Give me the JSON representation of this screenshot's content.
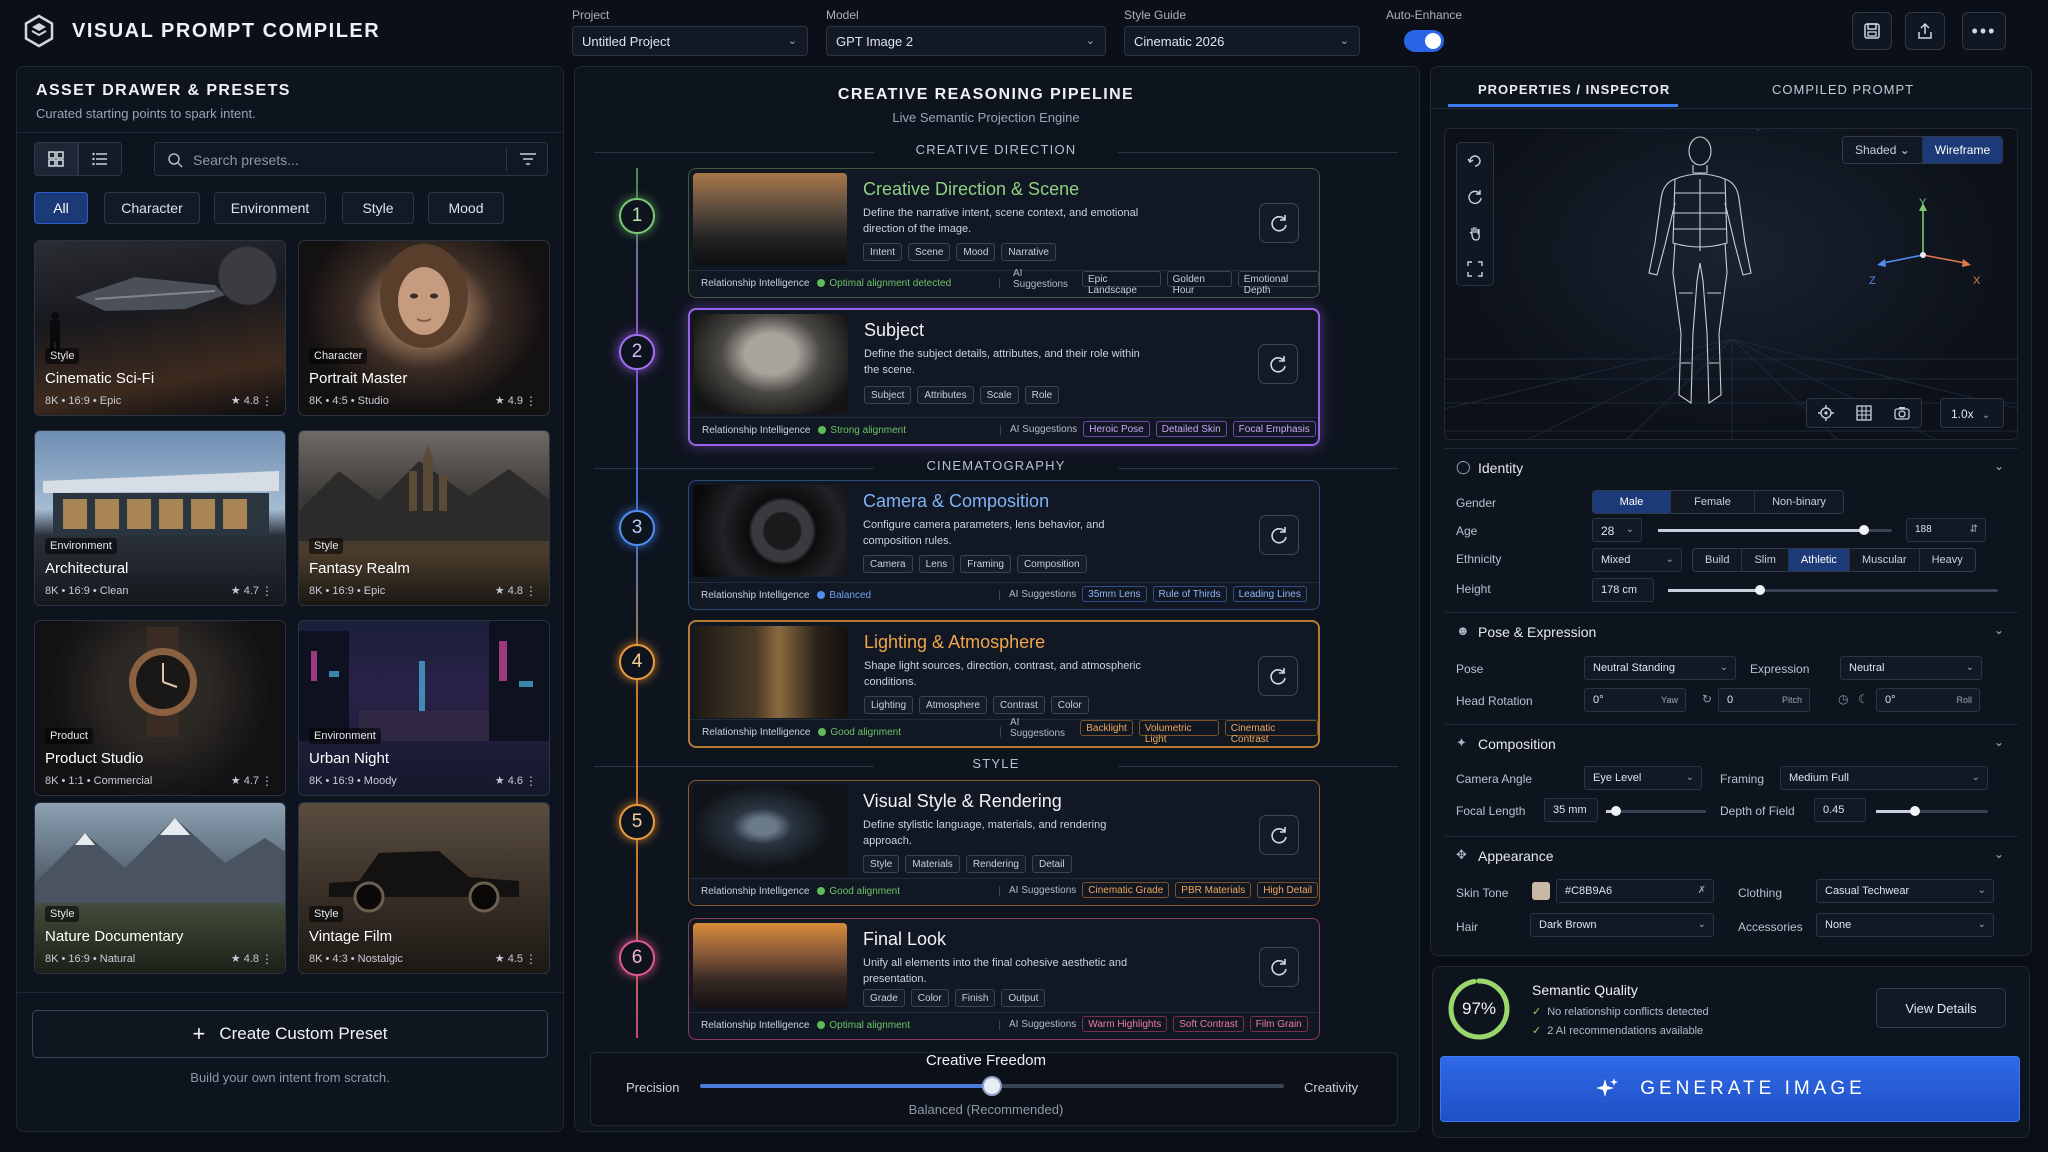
{
  "app": {
    "title": "VISUAL PROMPT COMPILER"
  },
  "topbar": {
    "project_label": "Project",
    "project_value": "Untitled Project",
    "model_label": "Model",
    "model_value": "GPT Image 2",
    "style_label": "Style Guide",
    "style_value": "Cinematic 2026",
    "auto_label": "Auto-Enhance",
    "auto_on": true,
    "icons": [
      "save-icon",
      "share-icon",
      "more-icon"
    ]
  },
  "assets": {
    "title": "ASSET DRAWER & PRESETS",
    "subtitle": "Curated starting points to spark intent.",
    "search_placeholder": "Search presets...",
    "filters": [
      "All",
      "Character",
      "Environment",
      "Style",
      "Mood"
    ],
    "active_filter": "All",
    "presets": [
      {
        "category": "Style",
        "name": "Cinematic Sci-Fi",
        "meta": "8K • 16:9 • Epic",
        "rating": "★ 4.8"
      },
      {
        "category": "Character",
        "name": "Portrait Master",
        "meta": "8K • 4:5 • Studio",
        "rating": "★ 4.9"
      },
      {
        "category": "Environment",
        "name": "Architectural",
        "meta": "8K • 16:9 • Clean",
        "rating": "★ 4.7"
      },
      {
        "category": "Style",
        "name": "Fantasy Realm",
        "meta": "8K • 16:9 • Epic",
        "rating": "★ 4.8"
      },
      {
        "category": "Product",
        "name": "Product Studio",
        "meta": "8K • 1:1 • Commercial",
        "rating": "★ 4.7"
      },
      {
        "category": "Environment",
        "name": "Urban Night",
        "meta": "8K • 16:9 • Moody",
        "rating": "★ 4.6"
      },
      {
        "category": "Style",
        "name": "Nature Documentary",
        "meta": "8K • 16:9 • Natural",
        "rating": "★ 4.8"
      },
      {
        "category": "Style",
        "name": "Vintage Film",
        "meta": "8K • 4:3 • Nostalgic",
        "rating": "★ 4.5"
      }
    ],
    "create_label": "Create Custom Preset",
    "create_hint": "Build your own intent from scratch."
  },
  "pipeline": {
    "title": "CREATIVE REASONING PIPELINE",
    "subtitle": "Live Semantic Projection Engine",
    "sections": [
      "CREATIVE DIRECTION",
      "CINEMATOGRAPHY",
      "STYLE"
    ],
    "ri_label": "Relationship Intelligence",
    "ai_label": "AI Suggestions",
    "steps": [
      {
        "n": "1",
        "title": "Creative Direction & Scene",
        "desc": "Define the narrative intent, scene context, and emotional direction of the image.",
        "tags": [
          "Intent",
          "Scene",
          "Mood",
          "Narrative"
        ],
        "status": "Optimal alignment detected",
        "suggestions": [
          "Epic Landscape",
          "Golden Hour",
          "Emotional Depth"
        ],
        "color": "#7cc873"
      },
      {
        "n": "2",
        "title": "Subject",
        "desc": "Define the subject details, attributes, and their role within the scene.",
        "tags": [
          "Subject",
          "Attributes",
          "Scale",
          "Role"
        ],
        "status": "Strong alignment",
        "suggestions": [
          "Heroic Pose",
          "Detailed Skin",
          "Focal Emphasis"
        ],
        "color": "#a46ef0"
      },
      {
        "n": "3",
        "title": "Camera & Composition",
        "desc": "Configure camera parameters, lens behavior, and composition rules.",
        "tags": [
          "Camera",
          "Lens",
          "Framing",
          "Composition"
        ],
        "status": "Balanced",
        "suggestions": [
          "35mm Lens",
          "Rule of Thirds",
          "Leading Lines"
        ],
        "color": "#4f8df0"
      },
      {
        "n": "4",
        "title": "Lighting & Atmosphere",
        "desc": "Shape light sources, direction, contrast, and atmospheric conditions.",
        "tags": [
          "Lighting",
          "Atmosphere",
          "Contrast",
          "Color"
        ],
        "status": "Good alignment",
        "suggestions": [
          "Backlight",
          "Volumetric Light",
          "Cinematic Contrast"
        ],
        "color": "#e89a3c"
      },
      {
        "n": "5",
        "title": "Visual Style & Rendering",
        "desc": "Define stylistic language, materials, and rendering approach.",
        "tags": [
          "Style",
          "Materials",
          "Rendering",
          "Detail"
        ],
        "status": "Good alignment",
        "suggestions": [
          "Cinematic Grade",
          "PBR Materials",
          "High Detail"
        ],
        "color": "#e89a3c"
      },
      {
        "n": "6",
        "title": "Final Look",
        "desc": "Unify all elements into the final cohesive aesthetic and presentation.",
        "tags": [
          "Grade",
          "Color",
          "Finish",
          "Output"
        ],
        "status": "Optimal alignment",
        "suggestions": [
          "Warm Highlights",
          "Soft Contrast",
          "Film Grain"
        ],
        "color": "#e0568e"
      }
    ],
    "freedom": {
      "title": "Creative Freedom",
      "left": "Precision",
      "right": "Creativity",
      "value_label": "Balanced (Recommended)",
      "value": 0.5
    }
  },
  "inspector": {
    "tabs": [
      "PROPERTIES / INSPECTOR",
      "COMPILED PROMPT"
    ],
    "active_tab": 0,
    "viewport": {
      "modes": [
        "Shaded",
        "Wireframe"
      ],
      "active_mode": "Wireframe",
      "zoom": "1.0x",
      "axes": [
        "Y",
        "Z",
        "X"
      ]
    },
    "identity": {
      "title": "Identity",
      "gender_label": "Gender",
      "gender_options": [
        "Male",
        "Female",
        "Non-binary"
      ],
      "gender_selected": "Male",
      "age_label": "Age",
      "age_value": "28",
      "age_max": "188",
      "age_fraction": 0.88,
      "ethnicity_label": "Ethnicity",
      "ethnicity_value": "Mixed",
      "build_options": [
        "Build",
        "Slim",
        "Athletic",
        "Muscular",
        "Heavy"
      ],
      "build_selected": "Athletic",
      "height_label": "Height",
      "height_value": "178 cm",
      "height_fraction": 0.28
    },
    "pose": {
      "title": "Pose & Expression",
      "pose_label": "Pose",
      "pose_value": "Neutral Standing",
      "expression_label": "Expression",
      "expression_value": "Neutral",
      "head_label": "Head Rotation",
      "yaw": "0°",
      "yaw_label": "Yaw",
      "pitch": "0",
      "pitch_label": "Pitch",
      "roll": "0°",
      "roll_label": "Roll"
    },
    "composition": {
      "title": "Composition",
      "angle_label": "Camera Angle",
      "angle_value": "Eye Level",
      "framing_label": "Framing",
      "framing_value": "Medium Full",
      "focal_label": "Focal Length",
      "focal_value": "35 mm",
      "focal_fraction": 0.1,
      "dof_label": "Depth of Field",
      "dof_value": "0.45",
      "dof_fraction": 0.35
    },
    "appearance": {
      "title": "Appearance",
      "skin_label": "Skin Tone",
      "skin_value": "#C8B9A6",
      "skin_color": "#C8B9A6",
      "clothing_label": "Clothing",
      "clothing_value": "Casual Techwear",
      "hair_label": "Hair",
      "hair_value": "Dark Brown",
      "accessories_label": "Accessories",
      "accessories_value": "None"
    },
    "quality": {
      "percent": "97%",
      "value": 0.97,
      "title": "Semantic Quality",
      "line1": "No relationship conflicts detected",
      "line2": "2  AI recommendations available",
      "details_label": "View Details"
    },
    "generate_label": "GENERATE  IMAGE"
  }
}
